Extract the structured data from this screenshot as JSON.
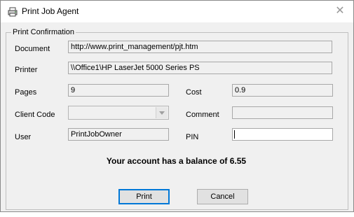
{
  "window": {
    "title": "Print Job Agent",
    "close_glyph": "✕",
    "app_icon": "printer-agent-icon"
  },
  "group": {
    "label": "Print Confirmation"
  },
  "fields": {
    "document": {
      "label": "Document",
      "value": "http://www.print_management/pjt.htm"
    },
    "printer": {
      "label": "Printer",
      "value": "\\\\Office1\\HP LaserJet 5000 Series PS"
    },
    "pages": {
      "label": "Pages",
      "value": "9"
    },
    "cost": {
      "label": "Cost",
      "value": "0.9"
    },
    "client_code": {
      "label": "Client Code",
      "value": ""
    },
    "comment": {
      "label": "Comment",
      "value": ""
    },
    "user": {
      "label": "User",
      "value": "PrintJobOwner"
    },
    "pin": {
      "label": "PIN",
      "value": ""
    }
  },
  "balance_text": "Your account has a balance of 6.55",
  "buttons": {
    "print": "Print",
    "cancel": "Cancel"
  }
}
